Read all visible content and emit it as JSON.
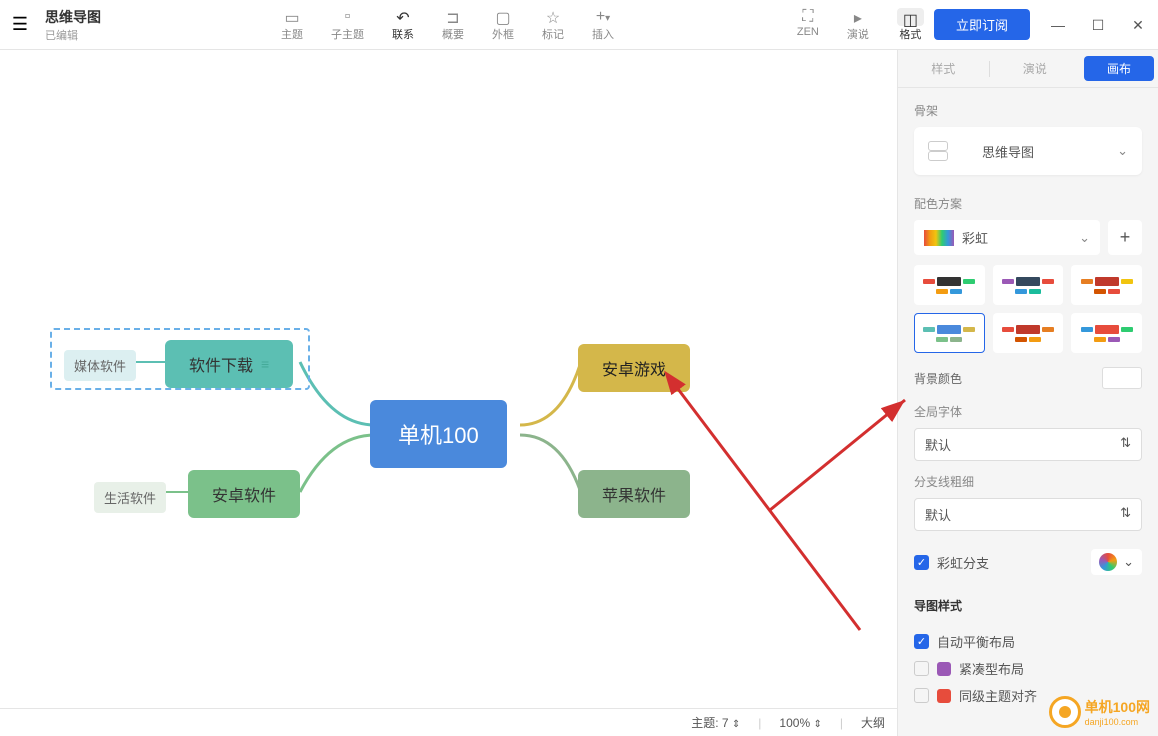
{
  "header": {
    "title": "思维导图",
    "status": "已编辑",
    "tools": [
      {
        "icon": "⬚",
        "label": "主题"
      },
      {
        "icon": "⬚",
        "label": "子主题"
      },
      {
        "icon": "↶",
        "label": "联系",
        "active": true
      },
      {
        "icon": "⊐",
        "label": "概要"
      },
      {
        "icon": "▭",
        "label": "外框"
      },
      {
        "icon": "☆",
        "label": "标记"
      },
      {
        "icon": "+·",
        "label": "插入"
      }
    ],
    "right_tools": [
      {
        "icon": "⛶",
        "label": "ZEN"
      },
      {
        "icon": "▸",
        "label": "演说"
      },
      {
        "icon": "◫",
        "label": "格式",
        "highlight": true
      }
    ],
    "subscribe": "立即订阅"
  },
  "mindmap": {
    "central": "单机100",
    "left": [
      {
        "text": "软件下载",
        "sub": "媒体软件",
        "color": "#5cbfb3"
      },
      {
        "text": "安卓软件",
        "sub": "生活软件",
        "color": "#7bc18a"
      }
    ],
    "right": [
      {
        "text": "安卓游戏",
        "color": "#d4b74a"
      },
      {
        "text": "苹果软件",
        "color": "#8cb48c"
      }
    ]
  },
  "statusbar": {
    "topics_label": "主题:",
    "topics_count": "7",
    "zoom": "100%",
    "outline": "大纲"
  },
  "sidebar": {
    "tabs": [
      "样式",
      "演说",
      "画布"
    ],
    "active_tab": 2,
    "skeleton": {
      "title": "骨架",
      "value": "思维导图"
    },
    "color_scheme": {
      "title": "配色方案",
      "value": "彩虹"
    },
    "bg_color": "背景颜色",
    "global_font": {
      "title": "全局字体",
      "value": "默认"
    },
    "branch_width": {
      "title": "分支线粗细",
      "value": "默认"
    },
    "rainbow_branch": "彩虹分支",
    "map_style": "导图样式",
    "auto_balance": "自动平衡布局",
    "compact": "紧凑型布局",
    "same_level": "同级主题对齐"
  },
  "watermark": {
    "cn": "单机100网",
    "en": "danji100.com"
  }
}
